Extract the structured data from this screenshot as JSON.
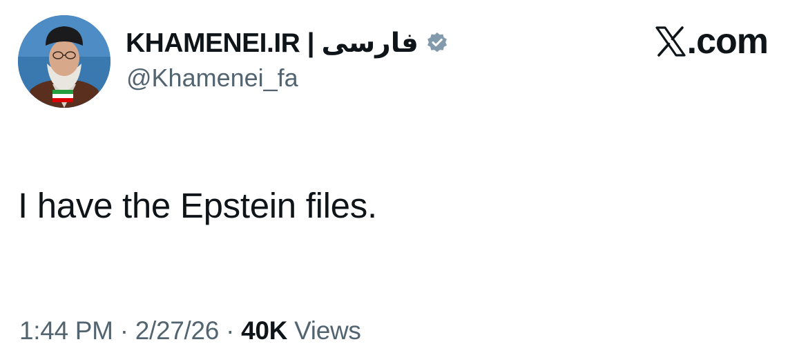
{
  "author": {
    "display_name": "KHAMENEI.IR | فارسی",
    "handle": "@Khamenei_fa",
    "verified_badge_icon": "verified-badge-icon",
    "avatar_icon": "avatar"
  },
  "brand": {
    "logo_icon": "x-logo-icon",
    "text": ".com"
  },
  "tweet": {
    "text": "I have the Epstein files."
  },
  "meta": {
    "time": "1:44 PM",
    "separator": "·",
    "date": "2/27/26",
    "views_count": "40K",
    "views_label": "Views"
  },
  "colors": {
    "primary_text": "#0f1419",
    "secondary_text": "#536471",
    "badge": "#829aab"
  }
}
